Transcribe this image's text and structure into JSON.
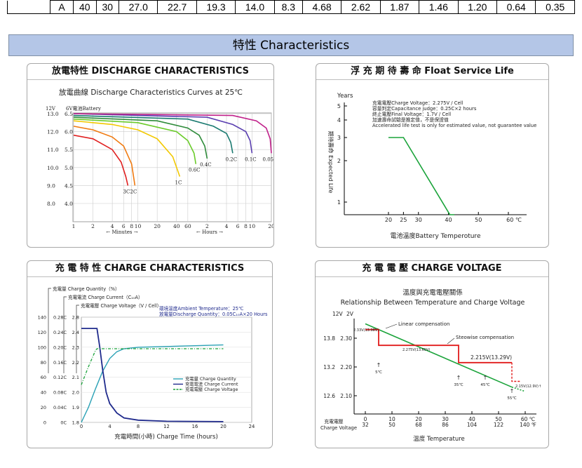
{
  "spec_table": {
    "row_label": "A",
    "cells": [
      "40",
      "30",
      "27.0",
      "22.7",
      "19.3",
      "14.0",
      "8.3",
      "4.68",
      "2.62",
      "1.87",
      "1.46",
      "1.20",
      "0.64",
      "0.35"
    ]
  },
  "section_title": "特性  Characteristics",
  "colors": {
    "band": "#b4c6e7",
    "green": "#1aa33a",
    "red": "#e11b1b",
    "teal": "#2aa1b5",
    "navy": "#1f2a8c"
  },
  "discharge": {
    "panel_title": "放電特性 DISCHARGE CHARACTERISTICS",
    "chart_data": {
      "type": "line",
      "title": "放電曲線 Discharge Characteristics Curves at 25℃",
      "ylabel_12v": "12V",
      "ylabel_6v": "6V電池Battery",
      "y_ticks_12v": [
        "13.0",
        "12.0",
        "11.0",
        "10.0",
        "9.0",
        "8.0"
      ],
      "y_ticks_6v": [
        "6.5",
        "6.0",
        "5.5",
        "5.0",
        "4.5",
        "4.0"
      ],
      "x_ticks": [
        "1",
        "2",
        "4",
        "6",
        "8",
        "10",
        "20",
        "40",
        "60",
        "2",
        "4",
        "6",
        "8",
        "10",
        "20"
      ],
      "x_label_minutes": "Minutes",
      "x_label_hours": "Hours",
      "series": [
        {
          "name": "3C",
          "x_minutes": [
            1,
            2,
            4,
            5.5,
            6.5,
            7
          ],
          "y_volts": [
            11.8,
            11.6,
            11.0,
            10.3,
            9.5,
            9.0
          ]
        },
        {
          "name": "2C",
          "x_minutes": [
            1,
            2,
            4,
            6,
            8,
            9
          ],
          "y_volts": [
            12.3,
            12.1,
            11.7,
            11.2,
            10.2,
            9.0
          ]
        },
        {
          "name": "1C",
          "x_minutes": [
            1,
            4,
            10,
            20,
            35,
            45
          ],
          "y_volts": [
            12.6,
            12.4,
            12.1,
            11.6,
            10.6,
            9.5
          ]
        },
        {
          "name": "0.6C",
          "x_minutes": [
            1,
            10,
            40,
            60,
            75,
            80
          ],
          "y_volts": [
            12.7,
            12.5,
            12.0,
            11.5,
            10.8,
            10.2
          ]
        },
        {
          "name": "0.4C",
          "x_minutes": [
            1,
            20,
            60,
            90,
            110,
            120
          ],
          "y_volts": [
            12.8,
            12.6,
            12.2,
            11.8,
            11.2,
            10.5
          ]
        },
        {
          "name": "0.2C",
          "x_minutes": [
            1,
            60,
            150,
            240,
            280,
            300
          ],
          "y_volts": [
            12.9,
            12.7,
            12.3,
            11.9,
            11.4,
            10.8
          ]
        },
        {
          "name": "0.1C",
          "x_minutes": [
            1,
            120,
            300,
            480,
            560,
            600
          ],
          "y_volts": [
            13.0,
            12.8,
            12.4,
            12.0,
            11.5,
            10.8
          ]
        },
        {
          "name": "0.05C",
          "x_minutes": [
            1,
            300,
            700,
            1000,
            1150,
            1200
          ],
          "y_volts": [
            13.0,
            12.9,
            12.6,
            12.2,
            11.6,
            10.8
          ]
        }
      ]
    }
  },
  "float": {
    "panel_title": "浮 充 期 待 壽 命 Float Service Life",
    "chart_data": {
      "type": "line",
      "ylabel_top": "Years",
      "ylabel": "期待壽命 Expected Life",
      "xlabel": "電池溫度Battery Temperoture",
      "y_ticks": [
        "5",
        "4",
        "3",
        "2",
        "1"
      ],
      "x_ticks": [
        "20",
        "25",
        "30",
        "40",
        "50",
        "60 ℃"
      ],
      "notes": [
        "充電電壓Charge Voltage：2.275V / Cell",
        "容量判定Capacitance judge：0.25C×2 hours",
        "終止電壓Final Voltage：1.7V / Cell",
        "加速壽命試驗是推定值，不是保證值",
        "Accelerated life test is only for estimated value, not guarantee value"
      ],
      "series": [
        {
          "x": [
            20,
            25,
            40.5,
            42
          ],
          "y": [
            3,
            3,
            0.6,
            0.6
          ]
        }
      ]
    }
  },
  "charge": {
    "panel_title": "充 電 特 性  CHARGE CHARACTERISTICS",
    "chart_data": {
      "type": "line",
      "axis_names": [
        "充電量  Charge Quantity（%）",
        "充電電流  Charge Current（C₁₀A）",
        "充電電壓  Charge Voltage（V / Cell）"
      ],
      "conditions": [
        "環境溫度Ambient Temperature：25℃",
        "放電量Discharge Quantity：0.05C₁₀A×20 Hours"
      ],
      "xlabel": "充電時間(小時)  Charge Time (hours)",
      "x_ticks": [
        "0",
        "4",
        "8",
        "12",
        "16",
        "20",
        "24"
      ],
      "y_quantity_ticks": [
        "140",
        "120",
        "100",
        "80",
        "60",
        "40",
        "20",
        "0"
      ],
      "y_current_ticks": [
        "0.28C",
        "0.24C",
        "0.20C",
        "0.16C",
        "0.12C",
        "0.08C",
        "0.04C",
        "0C"
      ],
      "y_voltage_ticks": [
        "2.8",
        "2.4",
        "2.3",
        "2.2",
        "2.1",
        "2.0",
        "1.9",
        "1.8"
      ],
      "legend": [
        {
          "name": "充電量      Charge Quantity"
        },
        {
          "name": "充電電流  Charge Current"
        },
        {
          "name": "充電電壓  Charge Voltage"
        }
      ],
      "series": [
        {
          "name": "Charge Quantity",
          "x": [
            0,
            1,
            2,
            3,
            4,
            5,
            6,
            8,
            12,
            16,
            20
          ],
          "y": [
            0,
            20,
            45,
            68,
            85,
            94,
            98,
            100,
            101,
            102,
            103
          ]
        },
        {
          "name": "Charge Current",
          "x": [
            0,
            2.2,
            2.6,
            3,
            3.5,
            4,
            5,
            6,
            8,
            12,
            20
          ],
          "y": [
            0.25,
            0.25,
            0.2,
            0.14,
            0.08,
            0.05,
            0.025,
            0.012,
            0.006,
            0.003,
            0.002
          ]
        },
        {
          "name": "Charge Voltage",
          "x": [
            0,
            1,
            2,
            2.2,
            3,
            8,
            20
          ],
          "y": [
            2.05,
            2.17,
            2.28,
            2.29,
            2.29,
            2.29,
            2.29
          ]
        }
      ]
    }
  },
  "voltage": {
    "panel_title": "充 電 電 壓  CHARGE VOLTAGE",
    "chart_data": {
      "type": "line",
      "title": "溫度與充電電壓關係",
      "subtitle": "Relationship Between Temperature and Charge Voltage",
      "y_12v_label": "12V",
      "y_2v_label": "2V",
      "y_12v_ticks": [
        "13.8",
        "13.2",
        "12.6"
      ],
      "y_2v_ticks": [
        "2.30",
        "2.20",
        "2.10"
      ],
      "x_c_ticks": [
        "0",
        "10",
        "20",
        "30",
        "40",
        "50",
        "60 ℃"
      ],
      "x_f_ticks": [
        "32",
        "50",
        "68",
        "86",
        "104",
        "122",
        "140 ℉"
      ],
      "xlabel": "溫度    Temperature",
      "ylabel": "充電電壓 Charge Voltage",
      "linear_label": "Linear compensation",
      "stepwise_label": "Steowise compensation",
      "step_labels": [
        "2.33V(13.98V)",
        "2.275V(13.65V)",
        "2.215V(13.29V)",
        "2.15V(12.9V)↑"
      ],
      "temp_marks": [
        "5℃",
        "35℃",
        "45℃",
        "55℃"
      ],
      "linear_series": {
        "x": [
          0,
          60
        ],
        "y": [
          2.35,
          2.12
        ]
      },
      "step_series": {
        "x": [
          0,
          5,
          5,
          35,
          35,
          45,
          45,
          55,
          55,
          58
        ],
        "y": [
          2.33,
          2.33,
          2.275,
          2.275,
          2.215,
          2.215,
          2.215,
          2.215,
          2.15,
          2.15
        ]
      }
    }
  }
}
